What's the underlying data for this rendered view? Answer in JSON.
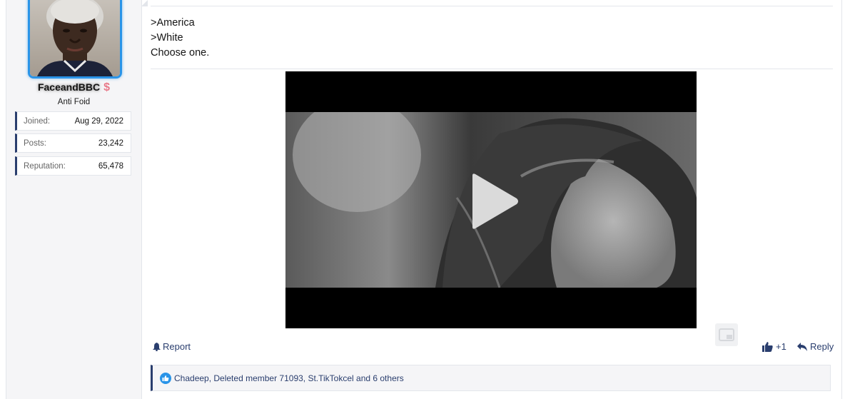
{
  "user": {
    "name": "FaceandBBC",
    "badge_symbol": "$",
    "title": "Anti Foid",
    "stats": [
      {
        "label": "Joined:",
        "value": "Aug 29, 2022"
      },
      {
        "label": "Posts:",
        "value": "23,242"
      },
      {
        "label": "Reputation:",
        "value": "65,478"
      }
    ],
    "accent_color": "#2a94e8"
  },
  "post": {
    "lines": [
      ">America",
      ">White",
      "Choose one."
    ]
  },
  "actions": {
    "report_label": "Report",
    "like_count": "+1",
    "reply_label": "Reply"
  },
  "reactions": {
    "text": "Chadeep, Deleted member 71093, St.TikTokcel and 6 others"
  },
  "colors": {
    "link": "#2a3e6e",
    "like_icon": "#2a94e8"
  }
}
